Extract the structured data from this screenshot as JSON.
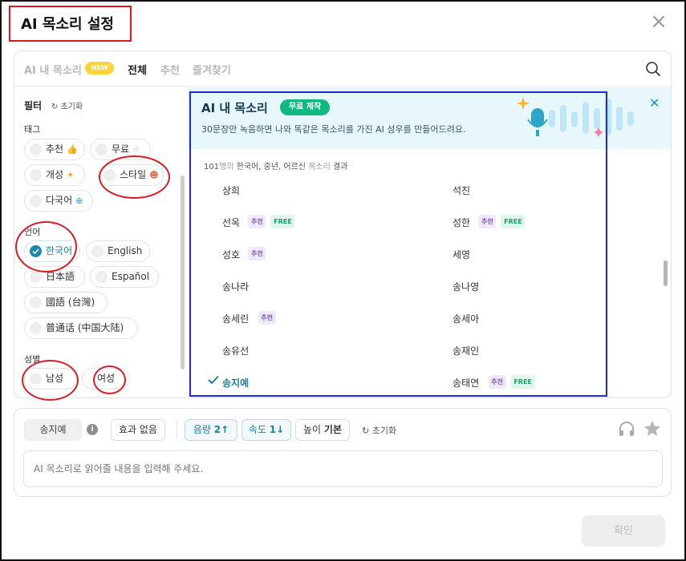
{
  "dialog": {
    "title": "AI 목소리 설정",
    "confirm_label": "확인"
  },
  "tabs": {
    "ai_voice": "AI 내 목소리",
    "new_badge": "NEW",
    "all": "전체",
    "recommended": "추천",
    "favorites": "즐겨찾기"
  },
  "filter": {
    "heading": "필터",
    "reset": "초기화",
    "tag_label": "태그",
    "tags": [
      "추천",
      "무료",
      "개성",
      "스타일",
      "다국어"
    ],
    "language_label": "언어",
    "languages": [
      "한국어",
      "English",
      "日本語",
      "Español",
      "國語 (台灣)",
      "普通话 (中国大陆)"
    ],
    "selected_language": "한국어",
    "gender_label": "성별",
    "genders": [
      "남성",
      "여성"
    ]
  },
  "banner": {
    "title": "AI 내 목소리",
    "badge": "무료 제작",
    "subtitle": "30문장만 녹음하면 나와 똑같은 목소리를 가진 AI 성우를 만들어드려요."
  },
  "results": {
    "count": "101",
    "unit": "명의",
    "criteria": "한국어, 중년, 어르신",
    "suffix_a": "목소리",
    "suffix_b": "결과"
  },
  "voice_tags": {
    "rec": "추천",
    "free": "FREE"
  },
  "voices": [
    {
      "name": "상희"
    },
    {
      "name": "석진"
    },
    {
      "name": "선옥",
      "rec": true,
      "free": true
    },
    {
      "name": "성한",
      "rec": true,
      "free": true
    },
    {
      "name": "성호",
      "rec": true
    },
    {
      "name": "세영"
    },
    {
      "name": "송나라"
    },
    {
      "name": "송나영"
    },
    {
      "name": "송세린",
      "rec": true
    },
    {
      "name": "송세아"
    },
    {
      "name": "송유선"
    },
    {
      "name": "송재인"
    },
    {
      "name": "송지예",
      "selected": true
    },
    {
      "name": "송태연",
      "rec": true,
      "free": true
    }
  ],
  "controls": {
    "voice": "송지예",
    "effect": "효과 없음",
    "volume_label": "음량",
    "volume_value": "2",
    "speed_label": "속도",
    "speed_value": "1",
    "pitch_label": "높이",
    "pitch_value": "기본",
    "reset": "초기화",
    "text_placeholder": "AI 목소리로 읽어줄 내용을 입력해 주세요."
  },
  "colors": {
    "accent": "#1b7fa6",
    "annotation_red": "#d81e25",
    "annotation_blue": "#1b2adb",
    "free_badge": "#10b981"
  }
}
